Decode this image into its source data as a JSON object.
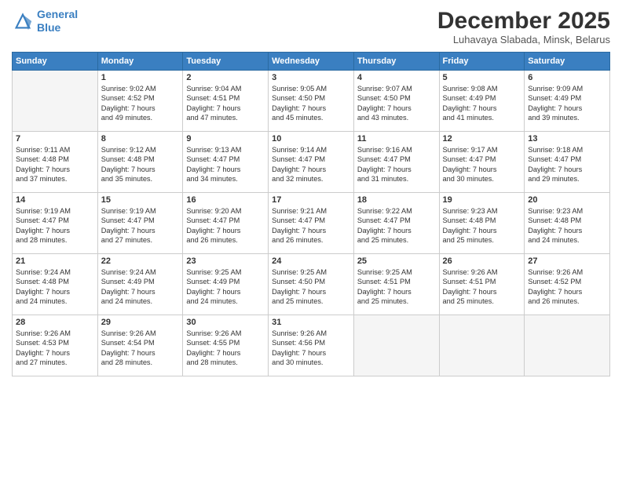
{
  "logo": {
    "line1": "General",
    "line2": "Blue"
  },
  "title": "December 2025",
  "subtitle": "Luhavaya Slabada, Minsk, Belarus",
  "days_of_week": [
    "Sunday",
    "Monday",
    "Tuesday",
    "Wednesday",
    "Thursday",
    "Friday",
    "Saturday"
  ],
  "weeks": [
    [
      {
        "day": "",
        "empty": true
      },
      {
        "day": "1",
        "sunrise": "Sunrise: 9:02 AM",
        "sunset": "Sunset: 4:52 PM",
        "daylight": "Daylight: 7 hours",
        "daylight2": "and 49 minutes."
      },
      {
        "day": "2",
        "sunrise": "Sunrise: 9:04 AM",
        "sunset": "Sunset: 4:51 PM",
        "daylight": "Daylight: 7 hours",
        "daylight2": "and 47 minutes."
      },
      {
        "day": "3",
        "sunrise": "Sunrise: 9:05 AM",
        "sunset": "Sunset: 4:50 PM",
        "daylight": "Daylight: 7 hours",
        "daylight2": "and 45 minutes."
      },
      {
        "day": "4",
        "sunrise": "Sunrise: 9:07 AM",
        "sunset": "Sunset: 4:50 PM",
        "daylight": "Daylight: 7 hours",
        "daylight2": "and 43 minutes."
      },
      {
        "day": "5",
        "sunrise": "Sunrise: 9:08 AM",
        "sunset": "Sunset: 4:49 PM",
        "daylight": "Daylight: 7 hours",
        "daylight2": "and 41 minutes."
      },
      {
        "day": "6",
        "sunrise": "Sunrise: 9:09 AM",
        "sunset": "Sunset: 4:49 PM",
        "daylight": "Daylight: 7 hours",
        "daylight2": "and 39 minutes."
      }
    ],
    [
      {
        "day": "7",
        "sunrise": "Sunrise: 9:11 AM",
        "sunset": "Sunset: 4:48 PM",
        "daylight": "Daylight: 7 hours",
        "daylight2": "and 37 minutes."
      },
      {
        "day": "8",
        "sunrise": "Sunrise: 9:12 AM",
        "sunset": "Sunset: 4:48 PM",
        "daylight": "Daylight: 7 hours",
        "daylight2": "and 35 minutes."
      },
      {
        "day": "9",
        "sunrise": "Sunrise: 9:13 AM",
        "sunset": "Sunset: 4:47 PM",
        "daylight": "Daylight: 7 hours",
        "daylight2": "and 34 minutes."
      },
      {
        "day": "10",
        "sunrise": "Sunrise: 9:14 AM",
        "sunset": "Sunset: 4:47 PM",
        "daylight": "Daylight: 7 hours",
        "daylight2": "and 32 minutes."
      },
      {
        "day": "11",
        "sunrise": "Sunrise: 9:16 AM",
        "sunset": "Sunset: 4:47 PM",
        "daylight": "Daylight: 7 hours",
        "daylight2": "and 31 minutes."
      },
      {
        "day": "12",
        "sunrise": "Sunrise: 9:17 AM",
        "sunset": "Sunset: 4:47 PM",
        "daylight": "Daylight: 7 hours",
        "daylight2": "and 30 minutes."
      },
      {
        "day": "13",
        "sunrise": "Sunrise: 9:18 AM",
        "sunset": "Sunset: 4:47 PM",
        "daylight": "Daylight: 7 hours",
        "daylight2": "and 29 minutes."
      }
    ],
    [
      {
        "day": "14",
        "sunrise": "Sunrise: 9:19 AM",
        "sunset": "Sunset: 4:47 PM",
        "daylight": "Daylight: 7 hours",
        "daylight2": "and 28 minutes."
      },
      {
        "day": "15",
        "sunrise": "Sunrise: 9:19 AM",
        "sunset": "Sunset: 4:47 PM",
        "daylight": "Daylight: 7 hours",
        "daylight2": "and 27 minutes."
      },
      {
        "day": "16",
        "sunrise": "Sunrise: 9:20 AM",
        "sunset": "Sunset: 4:47 PM",
        "daylight": "Daylight: 7 hours",
        "daylight2": "and 26 minutes."
      },
      {
        "day": "17",
        "sunrise": "Sunrise: 9:21 AM",
        "sunset": "Sunset: 4:47 PM",
        "daylight": "Daylight: 7 hours",
        "daylight2": "and 26 minutes."
      },
      {
        "day": "18",
        "sunrise": "Sunrise: 9:22 AM",
        "sunset": "Sunset: 4:47 PM",
        "daylight": "Daylight: 7 hours",
        "daylight2": "and 25 minutes."
      },
      {
        "day": "19",
        "sunrise": "Sunrise: 9:23 AM",
        "sunset": "Sunset: 4:48 PM",
        "daylight": "Daylight: 7 hours",
        "daylight2": "and 25 minutes."
      },
      {
        "day": "20",
        "sunrise": "Sunrise: 9:23 AM",
        "sunset": "Sunset: 4:48 PM",
        "daylight": "Daylight: 7 hours",
        "daylight2": "and 24 minutes."
      }
    ],
    [
      {
        "day": "21",
        "sunrise": "Sunrise: 9:24 AM",
        "sunset": "Sunset: 4:48 PM",
        "daylight": "Daylight: 7 hours",
        "daylight2": "and 24 minutes."
      },
      {
        "day": "22",
        "sunrise": "Sunrise: 9:24 AM",
        "sunset": "Sunset: 4:49 PM",
        "daylight": "Daylight: 7 hours",
        "daylight2": "and 24 minutes."
      },
      {
        "day": "23",
        "sunrise": "Sunrise: 9:25 AM",
        "sunset": "Sunset: 4:49 PM",
        "daylight": "Daylight: 7 hours",
        "daylight2": "and 24 minutes."
      },
      {
        "day": "24",
        "sunrise": "Sunrise: 9:25 AM",
        "sunset": "Sunset: 4:50 PM",
        "daylight": "Daylight: 7 hours",
        "daylight2": "and 25 minutes."
      },
      {
        "day": "25",
        "sunrise": "Sunrise: 9:25 AM",
        "sunset": "Sunset: 4:51 PM",
        "daylight": "Daylight: 7 hours",
        "daylight2": "and 25 minutes."
      },
      {
        "day": "26",
        "sunrise": "Sunrise: 9:26 AM",
        "sunset": "Sunset: 4:51 PM",
        "daylight": "Daylight: 7 hours",
        "daylight2": "and 25 minutes."
      },
      {
        "day": "27",
        "sunrise": "Sunrise: 9:26 AM",
        "sunset": "Sunset: 4:52 PM",
        "daylight": "Daylight: 7 hours",
        "daylight2": "and 26 minutes."
      }
    ],
    [
      {
        "day": "28",
        "sunrise": "Sunrise: 9:26 AM",
        "sunset": "Sunset: 4:53 PM",
        "daylight": "Daylight: 7 hours",
        "daylight2": "and 27 minutes."
      },
      {
        "day": "29",
        "sunrise": "Sunrise: 9:26 AM",
        "sunset": "Sunset: 4:54 PM",
        "daylight": "Daylight: 7 hours",
        "daylight2": "and 28 minutes."
      },
      {
        "day": "30",
        "sunrise": "Sunrise: 9:26 AM",
        "sunset": "Sunset: 4:55 PM",
        "daylight": "Daylight: 7 hours",
        "daylight2": "and 28 minutes."
      },
      {
        "day": "31",
        "sunrise": "Sunrise: 9:26 AM",
        "sunset": "Sunset: 4:56 PM",
        "daylight": "Daylight: 7 hours",
        "daylight2": "and 30 minutes."
      },
      {
        "day": "",
        "empty": true
      },
      {
        "day": "",
        "empty": true
      },
      {
        "day": "",
        "empty": true
      }
    ]
  ]
}
